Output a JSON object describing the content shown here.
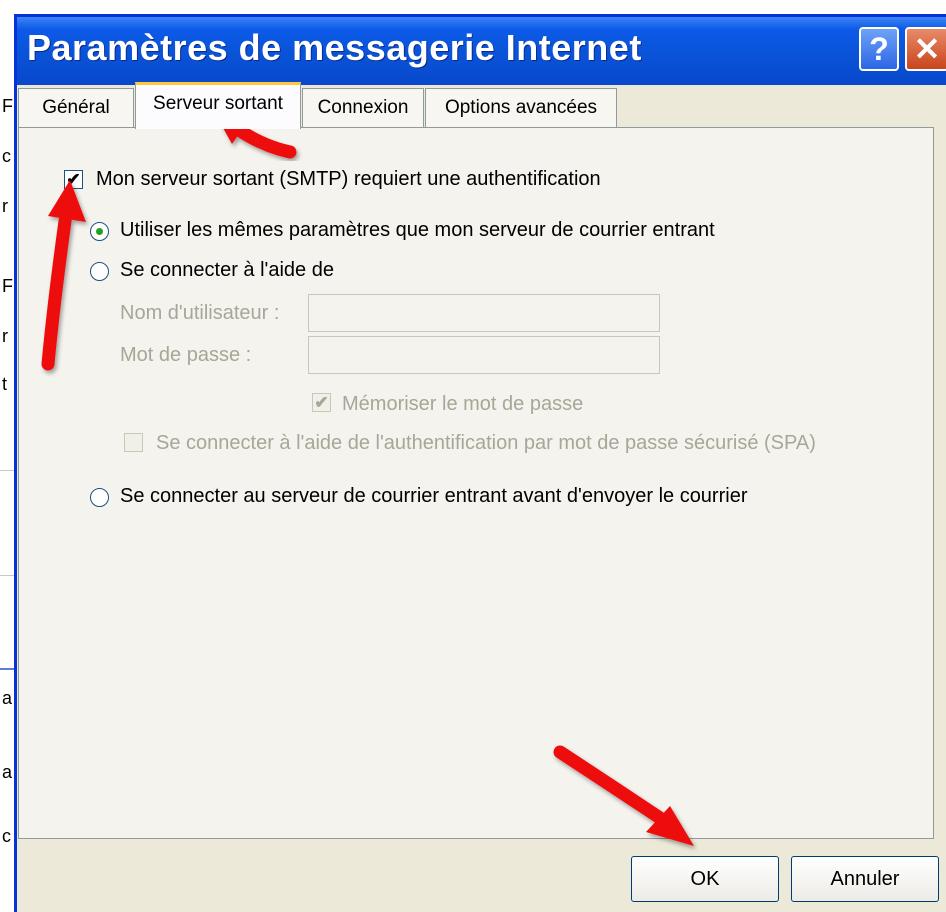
{
  "window": {
    "title": "Paramètres de messagerie Internet",
    "help_glyph": "?",
    "close_glyph": "✕"
  },
  "tabs": [
    {
      "label": "Général",
      "active": false
    },
    {
      "label": "Serveur sortant",
      "active": true
    },
    {
      "label": "Connexion",
      "active": false
    },
    {
      "label": "Options avancées",
      "active": false
    }
  ],
  "smtp_auth": {
    "label": "Mon serveur sortant (SMTP) requiert une authentification",
    "checked": true
  },
  "auth_options": {
    "same_settings": {
      "label": "Utiliser les mêmes paramètres que mon serveur de courrier entrant",
      "selected": true
    },
    "connect_with": {
      "label": "Se connecter à l'aide de",
      "selected": false
    },
    "incoming_first": {
      "label": "Se connecter au serveur de courrier entrant avant d'envoyer le courrier",
      "selected": false
    }
  },
  "credentials": {
    "username_label": "Nom d'utilisateur :",
    "username_value": "",
    "password_label": "Mot de passe :",
    "password_value": "",
    "remember_label": "Mémoriser le mot de passe",
    "remember_checked": true,
    "spa_label": "Se connecter à l'aide de l'authentification par mot de passe sécurisé (SPA)",
    "spa_checked": false
  },
  "buttons": {
    "ok": "OK",
    "cancel": "Annuler"
  },
  "check_glyph": "✔",
  "background_chars": [
    "F",
    "c",
    "r",
    "F",
    "r",
    "t",
    "a",
    "a",
    "c"
  ],
  "colors": {
    "titlebar": "#0a53d7",
    "dialog_bg": "#ece9d8",
    "annotation_arrow": "#ee1111",
    "active_tab_highlight": "#ffc83c",
    "radio_dot": "#21a121"
  }
}
